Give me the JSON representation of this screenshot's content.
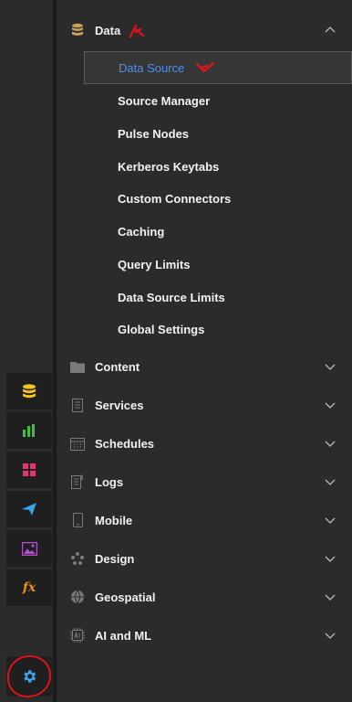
{
  "sidebar": {
    "items": [
      {
        "name": "data-rail",
        "icon": "database-icon",
        "color": "#f5c518"
      },
      {
        "name": "chart-rail",
        "icon": "bar-chart-icon",
        "color": "#3cc23c"
      },
      {
        "name": "dashboard-rail",
        "icon": "grid-icon",
        "color": "#e8336e"
      },
      {
        "name": "publish-rail",
        "icon": "paper-plane-icon",
        "color": "#3aa0e8"
      },
      {
        "name": "image-rail",
        "icon": "image-icon",
        "color": "#b44fd0"
      },
      {
        "name": "formula-rail",
        "icon": "function-icon",
        "color": "#e8901c",
        "text": "fx"
      },
      {
        "name": "settings-rail",
        "icon": "gear-icon",
        "color": "#3aa0e8"
      }
    ]
  },
  "menu": {
    "data": {
      "label": "Data",
      "children": [
        {
          "label": "Data Source",
          "active": true
        },
        {
          "label": "Source Manager"
        },
        {
          "label": "Pulse Nodes"
        },
        {
          "label": "Kerberos Keytabs"
        },
        {
          "label": "Custom Connectors"
        },
        {
          "label": "Caching"
        },
        {
          "label": "Query Limits"
        },
        {
          "label": "Data Source Limits"
        },
        {
          "label": "Global Settings"
        }
      ]
    },
    "sections": [
      {
        "label": "Content",
        "icon": "folder-icon"
      },
      {
        "label": "Services",
        "icon": "document-icon"
      },
      {
        "label": "Schedules",
        "icon": "calendar-icon"
      },
      {
        "label": "Logs",
        "icon": "log-file-icon"
      },
      {
        "label": "Mobile",
        "icon": "mobile-icon"
      },
      {
        "label": "Design",
        "icon": "palette-icon"
      },
      {
        "label": "Geospatial",
        "icon": "globe-icon"
      },
      {
        "label": "AI and ML",
        "icon": "ai-chip-icon"
      }
    ]
  },
  "colors": {
    "accent": "#4d8ff0",
    "annotation": "#d8141c",
    "data_icon": "#c9a15a"
  }
}
